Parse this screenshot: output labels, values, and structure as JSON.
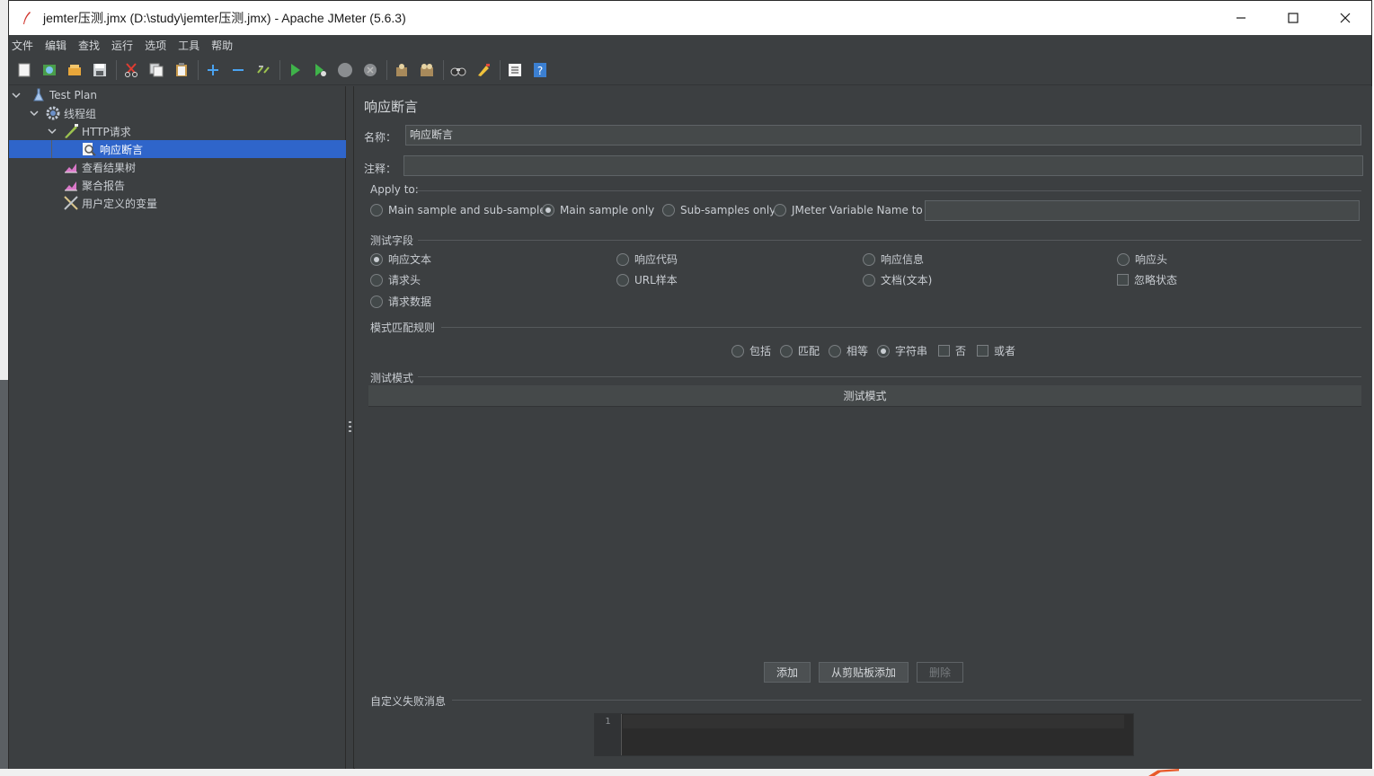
{
  "window": {
    "title": "jemter压测.jmx (D:\\study\\jemter压测.jmx) - Apache JMeter (5.6.3)"
  },
  "menu": [
    "文件",
    "编辑",
    "查找",
    "运行",
    "选项",
    "工具",
    "帮助"
  ],
  "toolbar": {
    "icons": [
      "new-icon",
      "templates-icon",
      "open-icon",
      "save-icon",
      "cut-icon",
      "copy-icon",
      "paste-icon",
      "expand-icon",
      "collapse-icon",
      "toggle-icon",
      "start-icon",
      "start-no-pause-icon",
      "stop-icon",
      "shutdown-icon",
      "clear-icon",
      "clear-all-icon",
      "search-icon",
      "reset-search-icon",
      "function-helper-icon",
      "help-icon"
    ]
  },
  "tree": {
    "nodes": [
      {
        "label": "Test Plan",
        "icon": "test-plan-icon"
      },
      {
        "label": "线程组",
        "icon": "gear-icon"
      },
      {
        "label": "HTTP请求",
        "icon": "sampler-icon"
      },
      {
        "label": "响应断言",
        "icon": "assertion-icon",
        "selected": true
      },
      {
        "label": "查看结果树",
        "icon": "listener-icon"
      },
      {
        "label": "聚合报告",
        "icon": "listener-icon"
      },
      {
        "label": "用户定义的变量",
        "icon": "config-icon"
      }
    ]
  },
  "panel": {
    "title": "响应断言",
    "name_label": "名称：",
    "name_value": "响应断言",
    "comment_label": "注释：",
    "comment_value": "",
    "apply_to": {
      "title": "Apply to:",
      "options": [
        "Main sample and sub-samples",
        "Main sample only",
        "Sub-samples only",
        "JMeter Variable Name to use"
      ],
      "selected": "Main sample only",
      "variable_value": ""
    },
    "test_field": {
      "title": "测试字段",
      "options": [
        "响应文本",
        "响应代码",
        "响应信息",
        "响应头",
        "请求头",
        "URL样本",
        "文档(文本)",
        "忽略状态",
        "请求数据"
      ],
      "selected": "响应文本"
    },
    "pattern_rules": {
      "title": "模式匹配规则",
      "options": [
        "包括",
        "匹配",
        "相等",
        "字符串",
        "否",
        "或者"
      ],
      "selected": "字符串"
    },
    "patterns": {
      "title": "测试模式",
      "column": "测试模式",
      "rows": []
    },
    "buttons": {
      "add": "添加",
      "add_clipboard": "从剪贴板添加",
      "delete": "删除"
    },
    "failure_message": {
      "title": "自定义失败消息",
      "line_number": "1",
      "value": ""
    }
  }
}
